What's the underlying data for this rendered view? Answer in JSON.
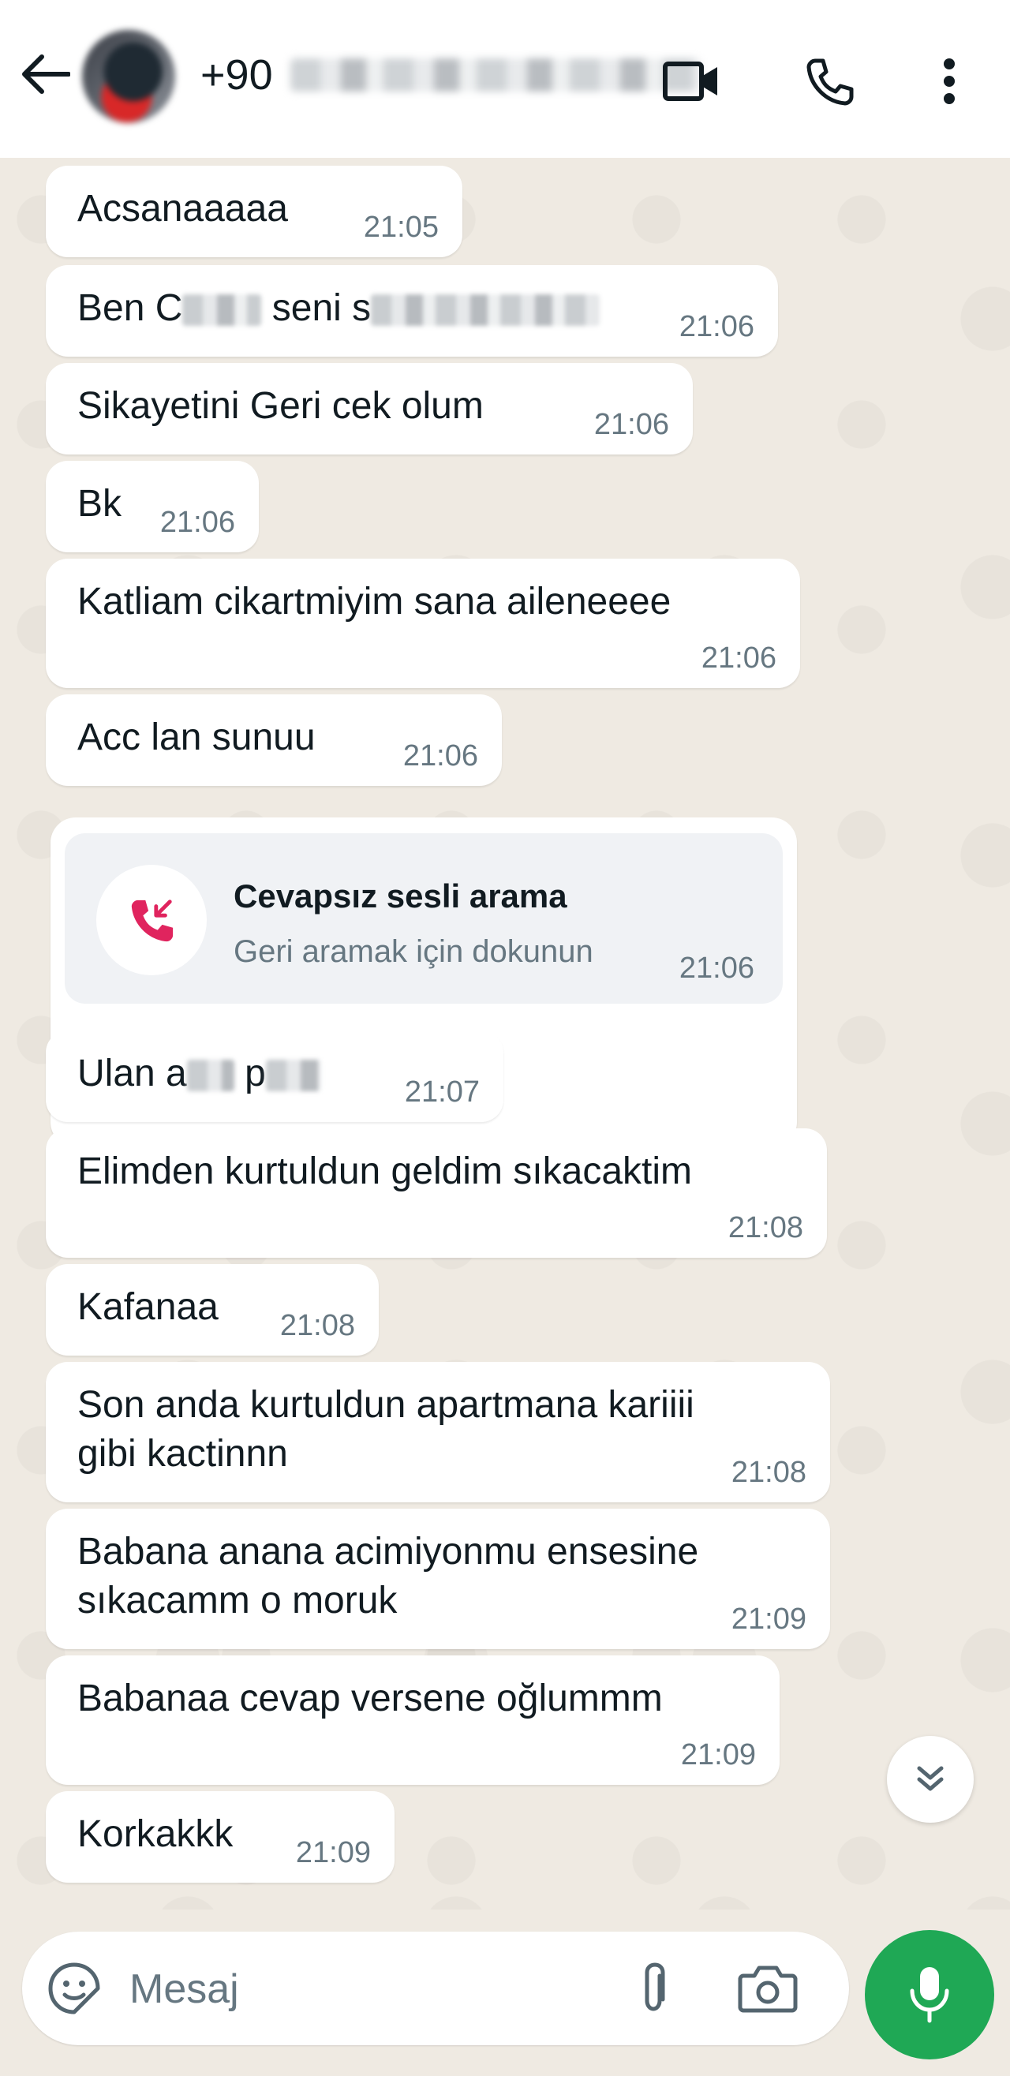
{
  "header": {
    "phone_prefix": "+90",
    "icons": {
      "back": "arrow-left-icon",
      "video": "video-camera-icon",
      "call": "phone-icon",
      "more": "more-vertical-icon"
    }
  },
  "messages": [
    {
      "text": "Acsanaaaaa",
      "time": "21:05"
    },
    {
      "text_before": "Ben C",
      "text_middle": " seni s",
      "time": "21:06"
    },
    {
      "text": "Sikayetini Geri cek olum",
      "time": "21:06"
    },
    {
      "text": "Bk",
      "time": "21:06"
    },
    {
      "text": "Katliam cikartmiyim sana aileneeee",
      "time": "21:06"
    },
    {
      "text": "Acc lan sunuu",
      "time": "21:06"
    },
    {
      "text_before": "Ulan a",
      "text_middle": " p",
      "time": "21:07"
    },
    {
      "text": "Elimden kurtuldun geldim sıkacaktim",
      "time": "21:08"
    },
    {
      "text": "Kafanaa",
      "time": "21:08"
    },
    {
      "line1": "Son anda kurtuldun apartmana kariiii",
      "line2": "gibi kactinnn",
      "time": "21:08"
    },
    {
      "line1": "Babana anana acimiyonmu ensesine",
      "line2": "sıkacamm o moruk",
      "time": "21:09"
    },
    {
      "text": "Babanaa cevap versene oğlummm",
      "time": "21:09"
    },
    {
      "text": "Korkakkk",
      "time": "21:09"
    }
  ],
  "missed_call": {
    "title": "Cevapsız sesli arama",
    "subtitle": "Geri aramak için dokunun",
    "time": "21:06",
    "icon": "missed-call-icon",
    "color": "#e0245e"
  },
  "composer": {
    "placeholder": "Mesaj",
    "icons": {
      "emoji": "sticker-icon",
      "attach": "paperclip-icon",
      "camera": "camera-icon",
      "mic": "microphone-icon"
    }
  },
  "colors": {
    "accent": "#1fa855",
    "chat_background": "#efeae2",
    "bubble": "#ffffff",
    "time_text": "#667781"
  }
}
